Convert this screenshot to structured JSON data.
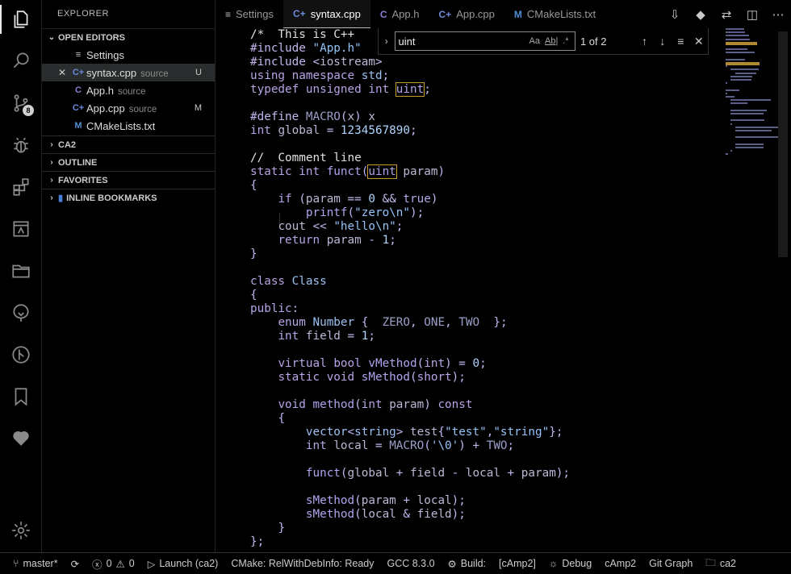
{
  "sidebar": {
    "title": "EXPLORER",
    "open_editors": {
      "label": "OPEN EDITORS",
      "items": [
        {
          "name": "Settings",
          "desc": "",
          "status": ""
        },
        {
          "name": "syntax.cpp",
          "desc": "source",
          "status": "U"
        },
        {
          "name": "App.h",
          "desc": "source",
          "status": ""
        },
        {
          "name": "App.cpp",
          "desc": "source",
          "status": "M"
        },
        {
          "name": "CMakeLists.txt",
          "desc": "",
          "status": ""
        }
      ]
    },
    "sections": [
      "CA2",
      "OUTLINE",
      "FAVORITES",
      "INLINE BOOKMARKS"
    ]
  },
  "activity": {
    "scm_badge": "8",
    "icons": [
      "files-icon",
      "search-icon",
      "source-control-icon",
      "debug-icon",
      "extensions-icon",
      "remote-icon",
      "folder-icon",
      "git-graph-icon",
      "branch-icon",
      "bookmark-icon",
      "heart-icon",
      "settings-gear-icon"
    ]
  },
  "tabs": [
    {
      "label": "Settings",
      "icon": "≡"
    },
    {
      "label": "syntax.cpp",
      "icon": "C+"
    },
    {
      "label": "App.h",
      "icon": "C"
    },
    {
      "label": "App.cpp",
      "icon": "C+"
    },
    {
      "label": "CMakeLists.txt",
      "icon": "M"
    }
  ],
  "find": {
    "query": "uint",
    "count": "1 of 2",
    "options": [
      "Aa",
      "Ab|",
      ".*"
    ]
  },
  "code": [
    "/*  This is C++ ",
    "#include \"App.h\"",
    "#include <iostream>",
    "using namespace std;",
    "typedef unsigned int uint;",
    "",
    "#define MACRO(x) x",
    "int global = 1234567890;",
    "",
    "//  Comment line",
    "static int funct(uint param)",
    "{",
    "    if (param == 0 && true)",
    "        printf(\"zero\\n\");",
    "    cout << \"hello\\n\";",
    "    return param - 1;",
    "}",
    "",
    "class Class",
    "{",
    "public:",
    "    enum Number {  ZERO, ONE, TWO  };",
    "    int field = 1;",
    "",
    "    virtual bool vMethod(int) = 0;",
    "    static void sMethod(short);",
    "",
    "    void method(int param) const",
    "    {",
    "        vector<string> test{\"test\",\"string\"};",
    "        int local = MACRO('\\0') + TWO;",
    "",
    "        funct(global + field - local + param);",
    "",
    "        sMethod(param + local);",
    "        sMethod(local & field);",
    "    }",
    "};"
  ],
  "status": {
    "branch": "master*",
    "errors": "0",
    "warnings": "0",
    "launch": "Launch (ca2)",
    "cmake": "CMake: RelWithDebInfo: Ready",
    "compiler": "GCC 8.3.0",
    "build": "Build:",
    "build_target": "[cAmp2]",
    "debug": "Debug",
    "target": "cAmp2",
    "git_graph": "Git Graph",
    "folder": "ca2"
  }
}
